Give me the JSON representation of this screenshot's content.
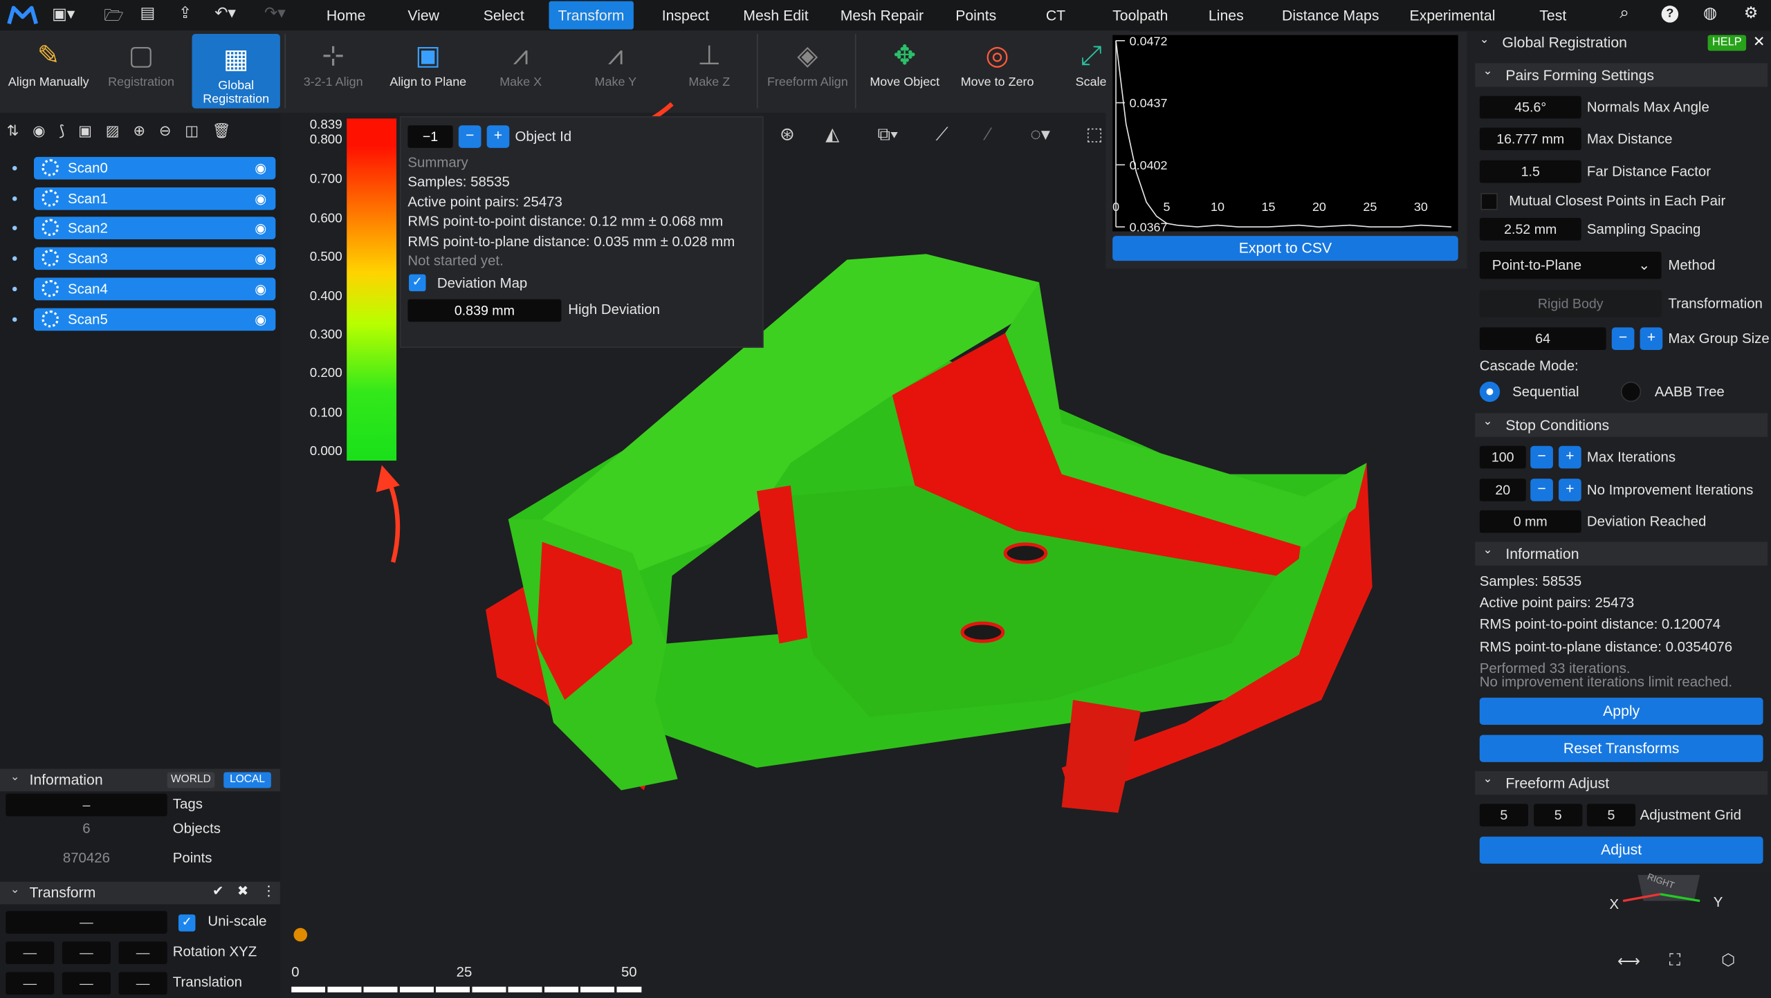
{
  "menu": [
    "Home",
    "View",
    "Select",
    "Transform",
    "Inspect",
    "Mesh Edit",
    "Mesh Repair",
    "Points",
    "CT",
    "Toolpath",
    "Lines",
    "Distance Maps",
    "Experimental",
    "Test"
  ],
  "menu_active": "Transform",
  "ribbon": [
    "Align Manually",
    "Registration",
    "Global Registration",
    "3-2-1 Align",
    "Align to Plane",
    "Make X",
    "Make Y",
    "Make Z",
    "Freeform Align",
    "Move Object",
    "Move to Zero",
    "Scale"
  ],
  "scans": [
    "Scan0",
    "Scan1",
    "Scan2",
    "Scan3",
    "Scan4",
    "Scan5"
  ],
  "info": {
    "title": "Information",
    "world": "WORLD",
    "local": "LOCAL",
    "tags_value": "–",
    "tags": "Tags",
    "objects_value": "6",
    "objects": "Objects",
    "points_value": "870426",
    "points": "Points"
  },
  "transform": {
    "title": "Transform",
    "scale_value": "—",
    "uniscale": "Uni-scale",
    "rot_values": [
      "—",
      "—",
      "—"
    ],
    "rotation": "Rotation XYZ",
    "trans_values": [
      "—",
      "—",
      "—"
    ],
    "translation": "Translation"
  },
  "legend": {
    "labels": [
      "0.839",
      "0.800",
      "0.700",
      "0.600",
      "0.500",
      "0.400",
      "0.300",
      "0.200",
      "0.100",
      "0.000"
    ]
  },
  "popup": {
    "obj_value": "−1",
    "obj_label": "Object Id",
    "summary": "Summary",
    "samples": "Samples: 58535",
    "pairs": "Active point pairs: 25473",
    "rms_pp": "RMS point-to-point distance: 0.12 mm ± 0.068 mm",
    "rms_pl": "RMS point-to-plane distance: 0.035 mm ± 0.028 mm",
    "status": "Not started yet.",
    "deviation_map": "Deviation Map",
    "high_value": "0.839 mm",
    "high_label": "High Deviation"
  },
  "plot": {
    "y_labels": [
      "0.0472",
      "0.0437",
      "0.0402",
      "0.0367"
    ],
    "x_labels": [
      "0",
      "5",
      "10",
      "15",
      "20",
      "25",
      "30"
    ],
    "export": "Export to CSV",
    "chart_data": {
      "type": "line",
      "x": [
        0,
        1,
        2,
        3,
        4,
        5,
        6,
        8,
        10,
        12,
        15,
        18,
        20,
        23,
        25,
        28,
        30,
        33
      ],
      "y": [
        0.0472,
        0.0425,
        0.0398,
        0.0381,
        0.0373,
        0.0369,
        0.0368,
        0.0367,
        0.0368,
        0.0367,
        0.0367,
        0.0368,
        0.0367,
        0.0368,
        0.0367,
        0.0367,
        0.0368,
        0.0367
      ],
      "ylim": [
        0.0367,
        0.0472
      ],
      "xlim": [
        0,
        33
      ]
    }
  },
  "gr": {
    "title": "Global Registration",
    "help": "HELP",
    "pairs_section": "Pairs Forming Settings",
    "normals_value": "45.6°",
    "normals": "Normals Max Angle",
    "maxdist_value": "16.777 mm",
    "maxdist": "Max Distance",
    "far_value": "1.5",
    "far": "Far Distance Factor",
    "mutual": "Mutual Closest Points in Each Pair",
    "sampling_value": "2.52 mm",
    "sampling": "Sampling Spacing",
    "method_value": "Point-to-Plane",
    "method": "Method",
    "transformation_value": "Rigid Body",
    "transformation": "Transformation",
    "group_value": "64",
    "group": "Max Group Size",
    "cascade": "Cascade Mode:",
    "sequential": "Sequential",
    "aabb": "AABB Tree",
    "stop_section": "Stop Conditions",
    "maxiter_value": "100",
    "maxiter": "Max Iterations",
    "noimp_value": "20",
    "noimp": "No Improvement Iterations",
    "devreach_value": "0 mm",
    "devreach": "Deviation Reached",
    "info_section": "Information",
    "samples": "Samples: 58535",
    "pairs": "Active point pairs: 25473",
    "rms_pp": "RMS point-to-point distance: 0.120074",
    "rms_pl": "RMS point-to-plane distance: 0.0354076",
    "performed": "Performed 33 iterations.",
    "noimp_reached": "No improvement iterations limit reached.",
    "apply": "Apply",
    "reset": "Reset Transforms",
    "freeform_section": "Freeform Adjust",
    "grid_values": [
      "5",
      "5",
      "5"
    ],
    "grid": "Adjustment Grid",
    "adjust": "Adjust"
  },
  "scalebar": [
    "0",
    "25",
    "50"
  ],
  "axes": {
    "x": "X",
    "y": "Y",
    "right": "RIGHT"
  }
}
